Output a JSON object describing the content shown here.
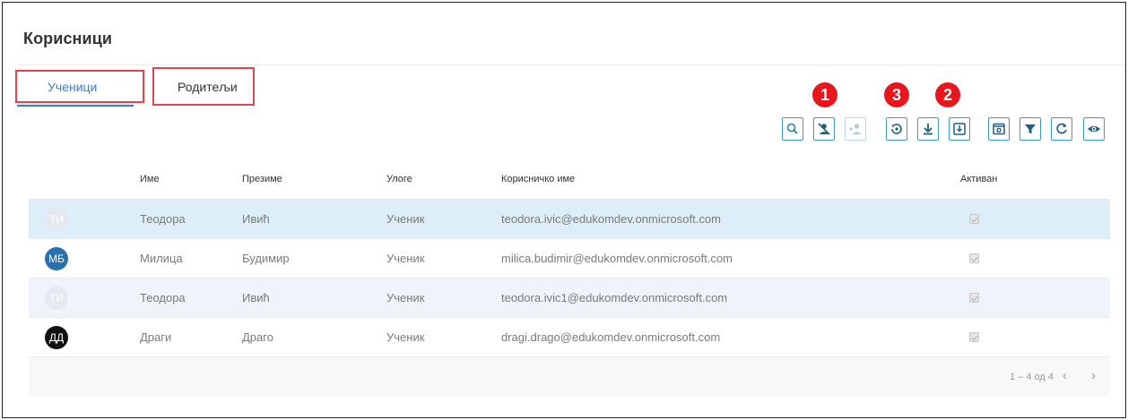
{
  "page": {
    "title": "Корисници"
  },
  "tabs": [
    {
      "label": "Ученици",
      "active": true
    },
    {
      "label": "Родитељи",
      "active": false
    }
  ],
  "annotations": [
    "1",
    "3",
    "2"
  ],
  "toolbar": {
    "buttons": [
      {
        "icon": "search-icon"
      },
      {
        "icon": "person-off-icon"
      },
      {
        "icon": "person-add-icon",
        "disabled": true
      },
      {
        "icon": "restore-icon"
      },
      {
        "icon": "download-icon"
      },
      {
        "icon": "import-icon"
      },
      {
        "icon": "view-icon"
      },
      {
        "icon": "filter-icon"
      },
      {
        "icon": "refresh-icon"
      },
      {
        "icon": "eye-icon"
      }
    ],
    "accent": "#3f9cc0"
  },
  "table": {
    "columns": [
      "Име",
      "Презиме",
      "Улоге",
      "Корисничко име",
      "Активан"
    ],
    "rows": [
      {
        "initials": "ТИ",
        "avatar_color": "#e4e9ee",
        "first": "Теодора",
        "last": "Ивић",
        "role": "Ученик",
        "username": "teodora.ivic@edukomdev.onmicrosoft.com",
        "active": true
      },
      {
        "initials": "МБ",
        "avatar_color": "#2a6fae",
        "first": "Милица",
        "last": "Будимир",
        "role": "Ученик",
        "username": "milica.budimir@edukomdev.onmicrosoft.com",
        "active": true
      },
      {
        "initials": "ТИ",
        "avatar_color": "#e4e9ee",
        "first": "Теодора",
        "last": "Ивић",
        "role": "Ученик",
        "username": "teodora.ivic1@edukomdev.onmicrosoft.com",
        "active": true
      },
      {
        "initials": "ДД",
        "avatar_color": "#111111",
        "first": "Драги",
        "last": "Драго",
        "role": "Ученик",
        "username": "dragi.drago@edukomdev.onmicrosoft.com",
        "active": true
      }
    ]
  },
  "pagination": {
    "range": "1 – 4 од 4",
    "prev": "‹",
    "next": "›"
  },
  "colors": {
    "tab_highlight": "#e0464f",
    "active_tab": "#3a7cc8",
    "badge": "#e8161d"
  }
}
